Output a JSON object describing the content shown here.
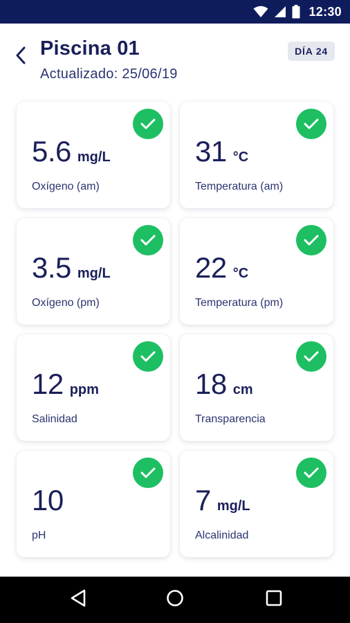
{
  "status_bar": {
    "time": "12:30"
  },
  "header": {
    "title": "Piscina 01",
    "updated": "Actualizado: 25/06/19",
    "badge": "DÍA 24"
  },
  "cards": [
    {
      "value": "5.6",
      "unit": "mg/L",
      "label": "Oxígeno (am)",
      "status": "ok"
    },
    {
      "value": "31",
      "unit": "°C",
      "label": "Temperatura (am)",
      "status": "ok"
    },
    {
      "value": "3.5",
      "unit": "mg/L",
      "label": "Oxígeno (pm)",
      "status": "ok"
    },
    {
      "value": "22",
      "unit": "°C",
      "label": "Temperatura (pm)",
      "status": "ok"
    },
    {
      "value": "12",
      "unit": "ppm",
      "label": "Salinidad",
      "status": "ok"
    },
    {
      "value": "18",
      "unit": "cm",
      "label": "Transparencia",
      "status": "ok"
    },
    {
      "value": "10",
      "unit": "",
      "label": "pH",
      "status": "ok"
    },
    {
      "value": "7",
      "unit": "mg/L",
      "label": "Alcalinidad",
      "status": "ok"
    }
  ],
  "icons": {
    "back": "back-arrow-icon",
    "check": "check-icon",
    "nav_back": "nav-back-icon",
    "nav_home": "nav-home-icon",
    "nav_recents": "nav-recents-icon"
  },
  "colors": {
    "primary": "#1a1f5a",
    "status_bar": "#0f1c5c",
    "ok": "#1dbf62",
    "badge_bg": "#e6e8ef"
  }
}
